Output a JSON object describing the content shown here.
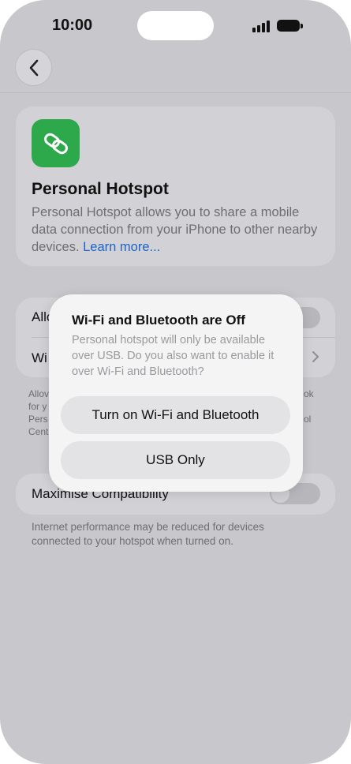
{
  "status": {
    "time": "10:00"
  },
  "nav": {
    "back_icon": "chevron-left-icon"
  },
  "header_card": {
    "icon": "link-icon",
    "icon_color": "#2da84b",
    "title": "Personal Hotspot",
    "description": "Personal Hotspot allows you to share a mobile data connection from your iPhone to other nearby devices.",
    "learn_more": "Learn more..."
  },
  "settings": {
    "row1_label": "Allo",
    "row2_label": "Wi",
    "footer_left": [
      "Allov",
      "for y",
      "Pers",
      "Cent"
    ],
    "footer_right": [
      "ok",
      "ol"
    ]
  },
  "compat": {
    "label": "Maximise Compatibility",
    "toggle_on": false,
    "footer": "Internet performance may be reduced for devices connected to your hotspot when turned on."
  },
  "dialog": {
    "title": "Wi-Fi and Bluetooth are Off",
    "message": "Personal hotspot will only be available over USB. Do you also want to enable it over Wi-Fi and Bluetooth?",
    "primary_button": "Turn on Wi-Fi and Bluetooth",
    "secondary_button": "USB Only"
  },
  "colors": {
    "accent_link": "#1b64c8",
    "dim_background": "#c8c7cc",
    "dialog_background": "#f4f4f4"
  }
}
